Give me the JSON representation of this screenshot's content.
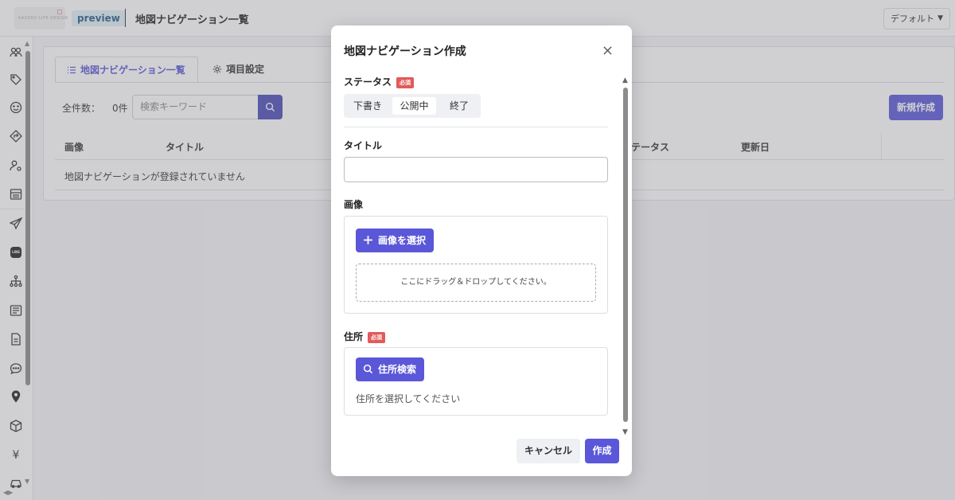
{
  "header": {
    "logo_text": "KAZOKU LIFE DESIGN",
    "preview_badge": "preview",
    "page_title": "地図ナビゲーション一覧",
    "default_select": "デフォルト"
  },
  "sidebar": {
    "icons": [
      "users-icon",
      "tag-icon",
      "smile-icon",
      "directions-icon",
      "user-settings-icon",
      "list-layout-icon",
      "send-icon",
      "line-icon",
      "sitemap-icon",
      "article-icon",
      "document-icon",
      "chat-icon",
      "map-pin-icon",
      "box-icon",
      "yen-icon",
      "car-icon"
    ],
    "yen": "¥",
    "line_label": "LINE"
  },
  "main": {
    "tabs": [
      {
        "label": "地図ナビゲーション一覧"
      },
      {
        "label": "項目設定"
      }
    ],
    "count_label": "全件数：",
    "count_value": "0件",
    "search_placeholder": "検索キーワード",
    "new_button": "新規作成",
    "columns": [
      "画像",
      "タイトル",
      "ステータス",
      "更新日"
    ],
    "empty_message": "地図ナビゲーションが登録されていません"
  },
  "modal": {
    "title": "地図ナビゲーション作成",
    "status_label": "ステータス",
    "required": "必須",
    "status_options": [
      "下書き",
      "公開中",
      "終了"
    ],
    "status_selected": "公開中",
    "title_label": "タイトル",
    "title_value": "",
    "image_label": "画像",
    "select_image_button": "画像を選択",
    "drop_text": "ここにドラッグ＆ドロップしてください。",
    "address_label": "住所",
    "address_search_button": "住所検索",
    "address_placeholder": "住所を選択してください",
    "cancel_button": "キャンセル",
    "create_button": "作成"
  },
  "colors": {
    "primary": "#5a57d8",
    "search_button": "#4a4ab8",
    "required_badge": "#e25b5b",
    "preview_badge_bg": "#dff0f6"
  }
}
